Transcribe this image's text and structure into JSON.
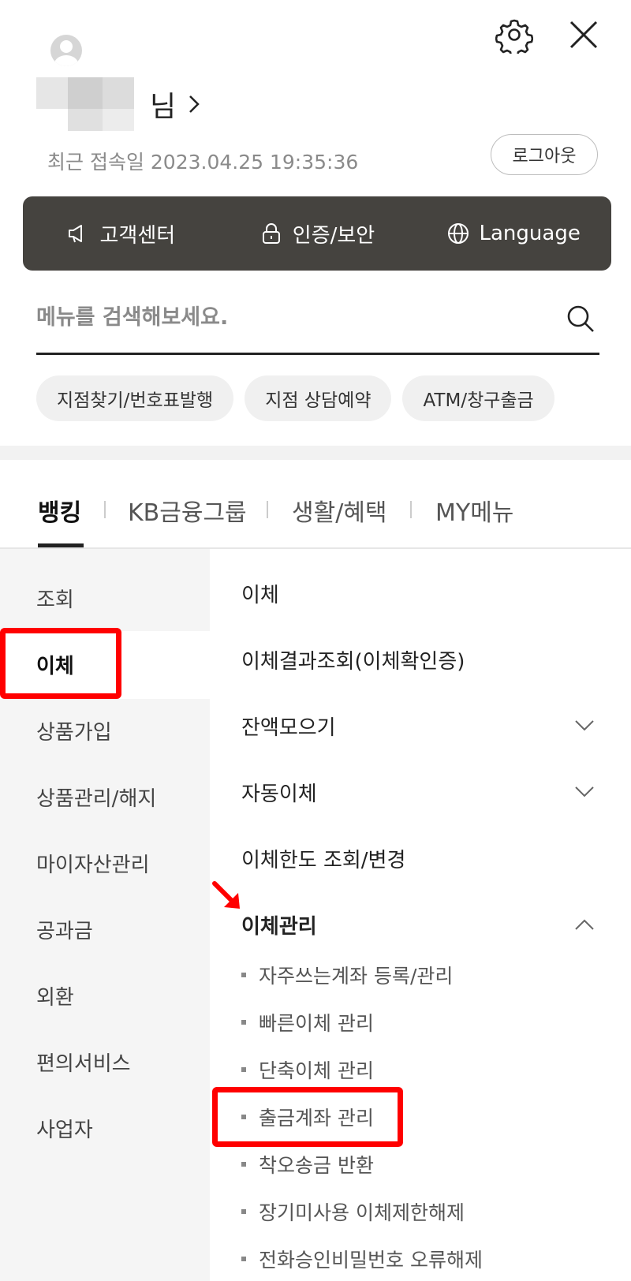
{
  "header": {
    "username_suffix": "님",
    "last_login": "최근 접속일 2023.04.25 19:35:36",
    "logout_label": "로그아웃"
  },
  "quickbar": {
    "items": [
      {
        "label": "고객센터",
        "icon": "megaphone-icon"
      },
      {
        "label": "인증/보안",
        "icon": "lock-icon"
      },
      {
        "label": "Language",
        "icon": "globe-icon"
      }
    ]
  },
  "search": {
    "placeholder": "메뉴를 검색해보세요."
  },
  "chips": [
    "지점찾기/번호표발행",
    "지점 상담예약",
    "ATM/창구출금"
  ],
  "tabs": [
    {
      "label": "뱅킹",
      "active": true
    },
    {
      "label": "KB금융그룹"
    },
    {
      "label": "생활/혜택"
    },
    {
      "label": "MY메뉴"
    }
  ],
  "leftnav": {
    "items": [
      "조회",
      "이체",
      "상품가입",
      "상품관리/해지",
      "마이자산관리",
      "공과금",
      "외환",
      "편의서비스",
      "사업자"
    ],
    "active_index": 1
  },
  "rightmenu": {
    "items": [
      {
        "label": "이체"
      },
      {
        "label": "이체결과조회(이체확인증)"
      },
      {
        "label": "잔액모으기",
        "chevron": "down"
      },
      {
        "label": "자동이체",
        "chevron": "down"
      },
      {
        "label": "이체한도 조회/변경"
      },
      {
        "label": "이체관리",
        "chevron": "up",
        "expanded": true
      }
    ],
    "sub_items": [
      "자주쓰는계좌 등록/관리",
      "빠른이체 관리",
      "단축이체 관리",
      "출금계좌 관리",
      "착오송금 반환",
      "장기미사용 이체제한해제",
      "전화승인비밀번호 오류해제"
    ]
  },
  "colors": {
    "highlight": "#ff0000",
    "quickbar_bg": "#45433f",
    "leftnav_bg": "#f5f5f5"
  }
}
